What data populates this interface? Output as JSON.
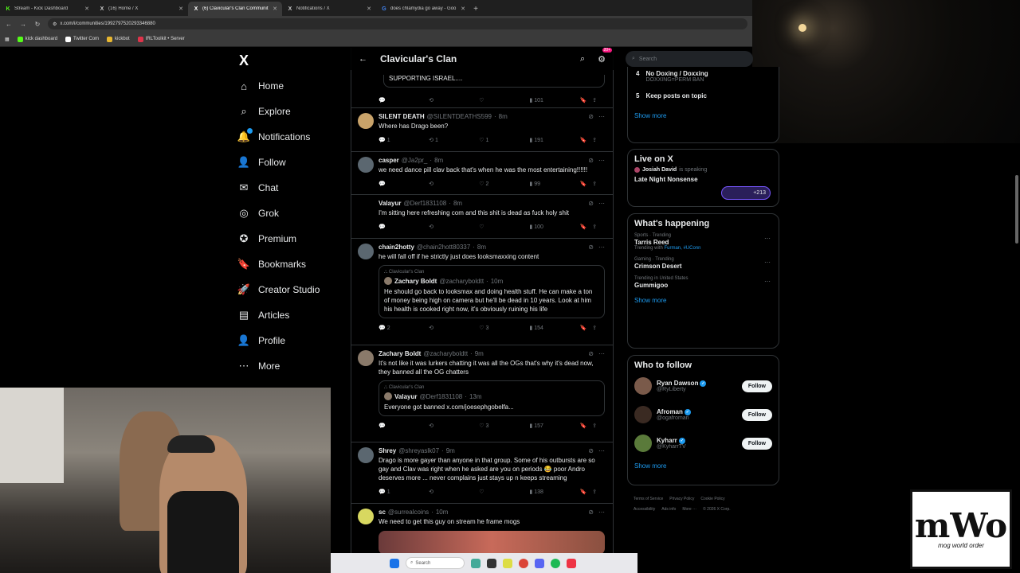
{
  "browser": {
    "tabs": [
      {
        "title": "Stream - Kick Dashboard",
        "icon": "K",
        "color": "#53fc18"
      },
      {
        "title": "(16) Home / X",
        "icon": "X",
        "color": "#ffffff"
      },
      {
        "title": "(6) Clavicular's Clan Communit",
        "icon": "X",
        "color": "#ffffff"
      },
      {
        "title": "Notifications / X",
        "icon": "X",
        "color": "#ffffff"
      },
      {
        "title": "does chlamydia go away - Goo",
        "icon": "G",
        "color": "#4285f4"
      }
    ],
    "url": "x.com/i/communities/1992797520293346880",
    "bookmarks": [
      {
        "label": "kick dashboard",
        "color": "#53fc18"
      },
      {
        "label": "Twitter Com",
        "color": "#ffffff"
      },
      {
        "label": "kickbot",
        "color": "#e8b730"
      },
      {
        "label": "IRLToolkit • Server",
        "color": "#e0334a"
      }
    ]
  },
  "nav": {
    "logo": "X",
    "items": [
      {
        "label": "Home",
        "icon": "⌂"
      },
      {
        "label": "Explore",
        "icon": "⌕"
      },
      {
        "label": "Notifications",
        "icon": "🔔"
      },
      {
        "label": "Follow",
        "icon": "👤"
      },
      {
        "label": "Chat",
        "icon": "✉"
      },
      {
        "label": "Grok",
        "icon": "◎"
      },
      {
        "label": "Premium",
        "icon": "✪"
      },
      {
        "label": "Bookmarks",
        "icon": "🔖"
      },
      {
        "label": "Creator Studio",
        "icon": "🚀"
      },
      {
        "label": "Articles",
        "icon": "▤"
      },
      {
        "label": "Profile",
        "icon": "👤"
      },
      {
        "label": "More",
        "icon": "⋯"
      }
    ]
  },
  "feed": {
    "title": "Clavicular's Clan",
    "badge": "20+",
    "top_quote_text": "SUPPORTING ISRAEL....",
    "top_views": "101",
    "posts": [
      {
        "name": "SILENT DEATH",
        "handle": "@SILENTDEATHS599",
        "time": "8m",
        "text": "Where has Drago been?",
        "replies": "1",
        "reposts": "1",
        "likes": "1",
        "views": "191",
        "avatar": "#c9a36a"
      },
      {
        "name": "casper",
        "handle": "@Ja2pr_",
        "time": "8m",
        "text": "we need dance pill clav back that's when he was the most entertaining!!!!!!",
        "replies": "",
        "reposts": "",
        "likes": "2",
        "views": "99",
        "avatar": "#5b6770"
      },
      {
        "name": "Valayur",
        "handle": "@Derf1831108",
        "time": "8m",
        "text": "I'm sitting here refreshing com and this shit is dead as fuck holy shit",
        "replies": "",
        "reposts": "",
        "likes": "",
        "views": "100",
        "avatar": "#000000"
      },
      {
        "name": "chain2hotty",
        "handle": "@chain2hott80337",
        "time": "8m",
        "text": "he will fall off if he strictly just does looksmaxxing content",
        "replies": "2",
        "reposts": "",
        "likes": "3",
        "views": "154",
        "avatar": "#5b6770",
        "quote": {
          "community": "Clavicular's Clan",
          "name": "Zachary Boldt",
          "handle": "@zacharyboldtt",
          "time": "10m",
          "text": "He should go back to looksmax and doing health stuff. He can make a ton of money being high on camera but he'll be dead in 10 years. Look at him his health is cooked right now, it's obviously ruining his life"
        }
      },
      {
        "name": "Zachary Boldt",
        "handle": "@zacharyboldtt",
        "time": "9m",
        "text": "It's not like it was lurkers chatting it was all the OGs that's why it's dead now, they banned all the OG chatters",
        "replies": "",
        "reposts": "",
        "likes": "3",
        "views": "157",
        "avatar": "#8a7a6a",
        "quote": {
          "community": "Clavicular's Clan",
          "name": "Valayur",
          "handle": "@Derf1831108",
          "time": "13m",
          "text": "Everyone got banned x.com/joesephgobelfa..."
        }
      },
      {
        "name": "Shrey",
        "handle": "@shreyaslk07",
        "time": "9m",
        "text": "Drago is more gayer than anyone in that group. Some of his outbursts are so gay and Clav was right when he asked are you on periods 😂 poor Andro deserves more ... never complains just stays up n keeps streaming",
        "replies": "1",
        "reposts": "",
        "likes": "",
        "views": "138",
        "avatar": "#5b6770"
      },
      {
        "name": "sc",
        "handle": "@surrealcoins",
        "time": "10m",
        "text": "We need to get this guy on stream he frame mogs",
        "avatar": "#d8d860"
      }
    ]
  },
  "right": {
    "search_placeholder": "Search",
    "rules": [
      {
        "num": "4",
        "title": "No Doxing / Doxxing",
        "sub": "DOXXING=PERM BAN"
      },
      {
        "num": "5",
        "title": "Keep posts on topic",
        "sub": ""
      }
    ],
    "show_more": "Show more",
    "live": {
      "heading": "Live on X",
      "host": "Josiah David",
      "status": "is speaking",
      "title": "Late Night Nonsense",
      "count": "+213"
    },
    "happening": {
      "heading": "What's happening",
      "trends": [
        {
          "meta": "Sports · Trending",
          "name": "Tarris Reed",
          "sub_prefix": "Trending with",
          "sub_links": "Furman, #UConn"
        },
        {
          "meta": "Gaming · Trending",
          "name": "Crimson Desert",
          "sub_prefix": "",
          "sub_links": ""
        },
        {
          "meta": "Trending in United States",
          "name": "Gummigoo",
          "sub_prefix": "",
          "sub_links": ""
        }
      ]
    },
    "who_to_follow": {
      "heading": "Who to follow",
      "accounts": [
        {
          "name": "Ryan Dawson",
          "handle": "@RyLiberty",
          "button": "Follow"
        },
        {
          "name": "Afroman",
          "handle": "@ogafroman",
          "button": "Follow"
        },
        {
          "name": "Kyharr",
          "handle": "@KyharrTV",
          "button": "Follow"
        }
      ]
    },
    "footer": [
      "Terms of Service",
      "Privacy Policy",
      "Cookie Policy",
      "Accessibility",
      "Ads info",
      "More ···",
      "© 2026 X Corp."
    ]
  },
  "taskbar": {
    "search_placeholder": "Search"
  },
  "watermark": {
    "big": "mWo",
    "small": "mog world order"
  }
}
